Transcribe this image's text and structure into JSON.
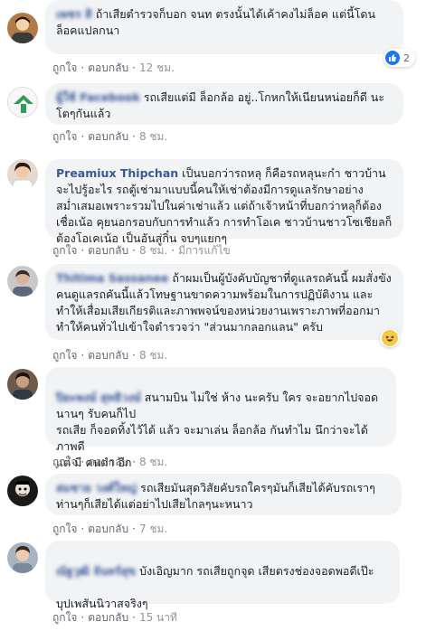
{
  "labels": {
    "like": "ถูกใจ",
    "reply": "ตอบกลับ",
    "separator": "·",
    "edited": "มีการแก้ไข"
  },
  "comments": [
    {
      "author": "เพชร สิ",
      "text": "ถ้าเสียตำรวจก็บอก จนท ตรงนั้นได้เค้าคงไม่ล็อค แต่นี้โดนล็อคแปลกนา",
      "time": "12 ชม.",
      "reaction": {
        "type": "like-icon",
        "count": "2"
      }
    },
    {
      "author": "ผู้ใช้ Facebook",
      "text": "รถเสียแต่มี ล็อกล้อ อยู่..โกหกให้เนียนหน่อยก็ดี นะโตๆกันแล้ว",
      "time": "8 ชม."
    },
    {
      "author": "Preamiux Thipchan",
      "text": "เป็นบอกว่ารถหลุ ก็คือรถหลุนะก๋า ชาวบ้านจะไปรู้อะไร รถตู้เช่ามาแบบนี้คนให้เช่าต้องมีการดูแลรักษาอย่างสม่ำเสมอเพราะรวมไปในค่าเช่าแล้ว แต่ถ้าเจ้าหน้าที่บอกว่าหลุก็ต้องเชื่อเน้อ คุยนอกรอบกับการทำแล้ว การทำโอเค ชาวบ้านชาวโซเชียลก็ต้องโอเคเน้อ เป็นอันสู่กิ๋น จบๆแยกๆ",
      "time": "8 ชม.",
      "edited": true
    },
    {
      "author": "Thitima Sassanee",
      "text": "ถ้าผมเป็นผู้บังคับบัญชาที่ดูแลรถคันนี้ ผมสั่งขังคนดูแลรถคันนี้แล้วโทษฐานขาดความพร้อมในการปฏิบัติงาน และทำให้เสื่อมเสียเกียรติและภาพพจน์ของหน่วยงานเพราะภาพที่ออกมาทำให้คนทั่วไปเข้าใจตำรวจว่า \"ส่วนมากลอกแลน\" ครับ",
      "time": "8 ชม.",
      "reaction": {
        "type": "haha-icon",
        "count": ""
      }
    },
    {
      "author": "ปิยะพงษ์ สุทธิวงษ์",
      "text": "สนามบิน ไม่ใช่ ห้าง นะครับ ใคร จะอยากไปจอดนานๆ รับคนก็ไป\nรถเสีย ก็จอดทิ้งไว้ได้ แล้ว จะมาเล่น ล็อกล้อ กันทำไม นึกว่าจะได้ภาพดี\nแต่ มี คนดำ อีก",
      "time": "8 ชม."
    },
    {
      "author": "สมชาย วงศ์ใหญ่",
      "text": "รถเสียมันสุดวิสัยคับรถใครๆมันก็เสียได้คับรถเราๆท่านๆก็เสียได้แต่อย่าไปเสียไกลๆนะหนาว",
      "time": "7 ชม."
    },
    {
      "author": "ณัฐวุฒิ จันทร์สุข",
      "text": "บังเอิญมาก รถเสียถูกจุด เสียตรงช่องจอดพอดีเป๊ะ\n\nบุปเพสันนิวาสจริงๆ",
      "time": "15 นาที"
    }
  ]
}
